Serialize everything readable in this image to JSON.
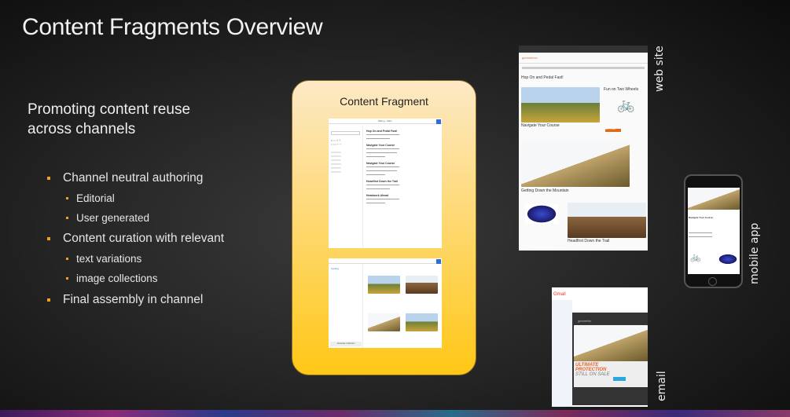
{
  "slide": {
    "title": "Content Fragments Overview",
    "subtitle_line1": "Promoting content reuse",
    "subtitle_line2": "across channels",
    "bullets": [
      {
        "text": "Channel neutral authoring",
        "level": 1
      },
      {
        "text": "Editorial",
        "level": 2
      },
      {
        "text": "User generated",
        "level": 2
      },
      {
        "text": "Content curation with relevant",
        "level": 1
      },
      {
        "text": "text variations",
        "level": 2
      },
      {
        "text": "image collections",
        "level": 2
      },
      {
        "text": "Final assembly in channel",
        "level": 1
      }
    ],
    "accent": "#f0a020"
  },
  "fragment": {
    "title": "Content Fragment",
    "editor": {
      "headings": [
        "Hop On and Pedal Fast!",
        "Navigate Your Course",
        "Navigate Your Course",
        "Headfirst Down the Trail",
        "Headwork Ahead"
      ],
      "toolbar_title": "Biking - Main"
    },
    "collection": {
      "header": "Cycling",
      "button": "Associate Collection"
    }
  },
  "channels": {
    "web": "web site",
    "mobile": "mobile app",
    "email": "email"
  },
  "website": {
    "brand": "geometrixx",
    "headline": "Hop On and Pedal Fast!",
    "side": "Fun on Two Wheels",
    "h2": "Navigate Your Course",
    "h3": "Getting Down the Mountain",
    "h4": "Headfirst Down the Trail",
    "cta": "ADD TO CART"
  },
  "mobile": {
    "heading": "Navigate Your Course"
  },
  "email": {
    "logo": "Gmail",
    "brand": "geometrixx",
    "line1": "ULTIMATE",
    "line2": "PROTECTION",
    "line3": "STILL ON SALE"
  }
}
